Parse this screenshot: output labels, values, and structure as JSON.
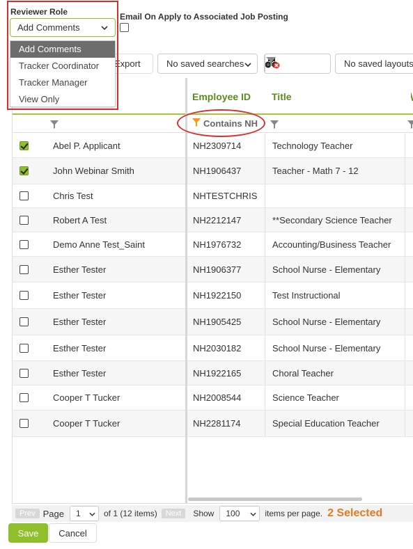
{
  "form": {
    "reviewer_role_label": "Reviewer Role",
    "reviewer_role_value": "Add Comments",
    "reviewer_role_options": [
      "Add Comments",
      "Tracker Coordinator",
      "Tracker Manager",
      "View Only"
    ],
    "email_label": "Email On Apply to Associated Job Posting"
  },
  "toolbar": {
    "export_label": "Export",
    "saved_searches": "No saved searches",
    "saved_layouts": "No saved layouts"
  },
  "grid": {
    "columns": [
      "Employee ID",
      "Title"
    ],
    "filter_text": "Contains NH",
    "rows": [
      {
        "name": "Abel P. Applicant",
        "id": "NH2309714",
        "title": "Technology Teacher",
        "checked": true
      },
      {
        "name": "John Webinar Smith",
        "id": "NH1906437",
        "title": "Teacher - Math 7 - 12",
        "checked": true
      },
      {
        "name": "Chris Test",
        "id": "NHTESTCHRIS",
        "title": "",
        "checked": false
      },
      {
        "name": "Robert A Test",
        "id": "NH2212147",
        "title": "**Secondary Science Teacher",
        "checked": false
      },
      {
        "name": "Demo Anne Test_Saint",
        "id": "NH1976732",
        "title": "Accounting/Business Teacher",
        "checked": false
      },
      {
        "name": "Esther Tester",
        "id": "NH1906377",
        "title": "School Nurse - Elementary",
        "checked": false
      },
      {
        "name": "Esther Tester",
        "id": "NH1922150",
        "title": "Test Instructional",
        "checked": false
      },
      {
        "name": "Esther Tester",
        "id": "NH1905425",
        "title": "School Nurse - Elementary",
        "checked": false
      },
      {
        "name": "Esther Tester",
        "id": "NH2030182",
        "title": "School Nurse - Elementary",
        "checked": false
      },
      {
        "name": "Esther Tester",
        "id": "NH1922165",
        "title": "Choral Teacher",
        "checked": false
      },
      {
        "name": "Cooper T Tucker",
        "id": "NH2008544",
        "title": "Science Teacher",
        "checked": false
      },
      {
        "name": "Cooper T Tucker",
        "id": "NH2281174",
        "title": "Special Education Teacher",
        "checked": false
      }
    ]
  },
  "pager": {
    "prev": "Prev",
    "page_label": "Page",
    "page_value": "1",
    "of_text": "of 1 (12 items)",
    "next": "Next",
    "show_label": "Show",
    "per_page_value": "100",
    "per_page_suffix": "items per page.",
    "selected_text": "2 Selected"
  },
  "footer": {
    "save": "Save",
    "cancel": "Cancel"
  },
  "colors": {
    "accent_green": "#8fbf2a",
    "header_green": "#5d8a1f",
    "annotation_red": "#d32f2f",
    "selected_orange": "#e07b24",
    "filter_orange": "#f39c12"
  }
}
